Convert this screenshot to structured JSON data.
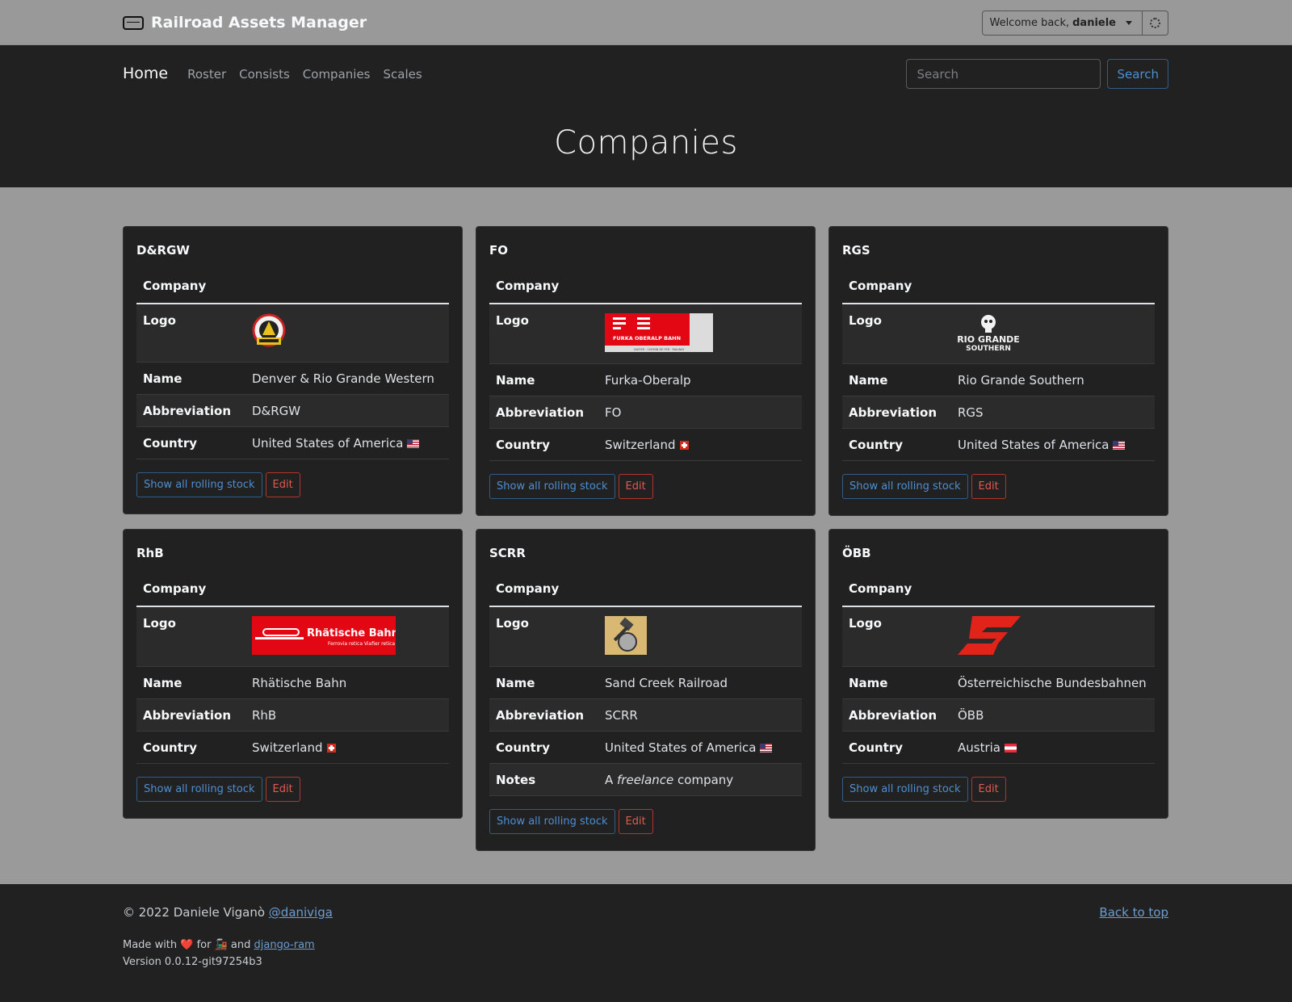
{
  "app": {
    "title": "Railroad Assets Manager",
    "user_prefix": "Welcome back, ",
    "user_name": "daniele"
  },
  "nav": {
    "home": "Home",
    "items": [
      "Roster",
      "Consists",
      "Companies",
      "Scales"
    ],
    "search_placeholder": "Search",
    "search_button": "Search"
  },
  "page_title": "Companies",
  "labels": {
    "company": "Company",
    "logo": "Logo",
    "name": "Name",
    "abbreviation": "Abbreviation",
    "country": "Country",
    "notes": "Notes",
    "show_button": "Show all rolling stock",
    "edit_button": "Edit"
  },
  "companies": [
    {
      "title": "D&RGW",
      "name": "Denver & Rio Grande Western",
      "abbreviation": "D&RGW",
      "country": "United States of America",
      "flag": "us-flag"
    },
    {
      "title": "FO",
      "name": "Furka-Oberalp",
      "abbreviation": "FO",
      "country": "Switzerland",
      "flag": "ch-flag",
      "logo_text": "FURKA OBERALP BAHN",
      "logo_sub": "VIAFIER · CHEMIN DE FER · RAILWAY"
    },
    {
      "title": "RGS",
      "name": "Rio Grande Southern",
      "abbreviation": "RGS",
      "country": "United States of America",
      "flag": "us-flag",
      "logo_text": "RIO GRANDE",
      "logo_sub": "SOUTHERN"
    },
    {
      "title": "RhB",
      "name": "Rhätische Bahn",
      "abbreviation": "RhB",
      "country": "Switzerland",
      "flag": "ch-flag",
      "logo_text": "Rhätische Bahn",
      "logo_sub": "Ferrovia retica  Viafier retica"
    },
    {
      "title": "SCRR",
      "name": "Sand Creek Railroad",
      "abbreviation": "SCRR",
      "country": "United States of America",
      "flag": "us-flag",
      "notes_pre": "A ",
      "notes_em": "freelance",
      "notes_post": " company"
    },
    {
      "title": "ÖBB",
      "name": "Österreichische Bundesbahnen",
      "abbreviation": "ÖBB",
      "country": "Austria",
      "flag": "at-flag"
    }
  ],
  "footer": {
    "copyright": "© 2022 Daniele Viganò ",
    "handle": "@daniviga",
    "back_to_top": "Back to top",
    "made_pre": "Made with ",
    "heart": "❤️",
    "made_mid": " for ",
    "train": "🚂",
    "made_and": " and ",
    "made_link": "django-ram",
    "version": "Version 0.0.12-git97254b3"
  },
  "colors": {
    "topbar": "#999999",
    "hero": "#212121",
    "body": "#9a9a9a",
    "card": "#212121",
    "primary_outline": "#4f8fd0",
    "danger_outline": "#e05a4f"
  }
}
